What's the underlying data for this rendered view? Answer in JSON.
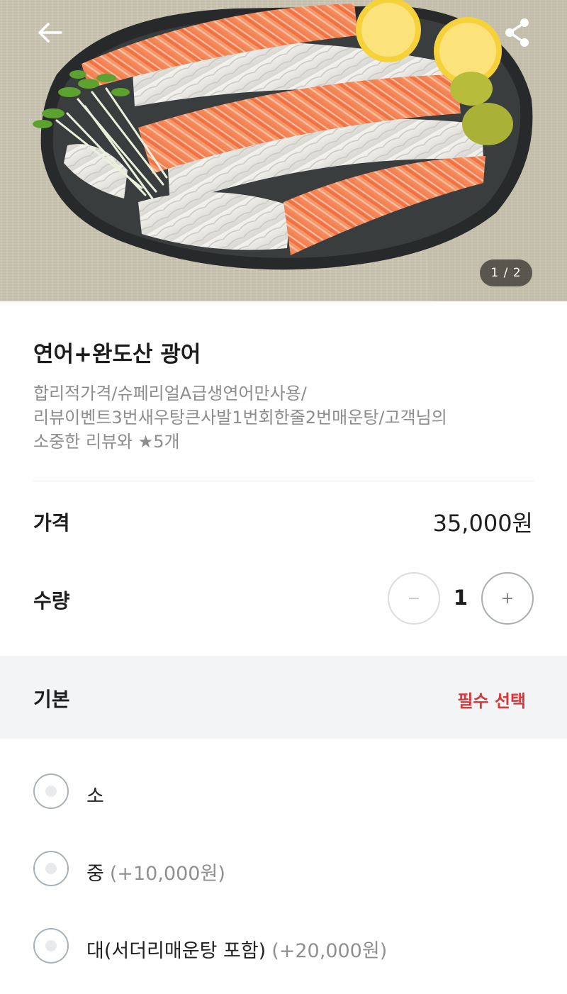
{
  "header": {
    "back_icon": "arrow-left-icon",
    "share_icon": "share-icon",
    "image_counter": "1 / 2"
  },
  "product": {
    "name": "연어+완도산 광어",
    "description_lines": [
      "합리적가격/슈페리얼A급생연어만사용/",
      "리뷰이벤트3번새우탕큰사발1번회한줄2번매운탕/고객님의",
      "소중한 리뷰와 ★5개"
    ]
  },
  "price": {
    "label": "가격",
    "value": "35,000원"
  },
  "quantity": {
    "label": "수량",
    "value": "1",
    "minus": "−",
    "plus": "+"
  },
  "option_group": {
    "title": "기본",
    "required_text": "필수 선택",
    "options": [
      {
        "label": "소",
        "extra": ""
      },
      {
        "label": "중",
        "extra": "(+10,000원)"
      },
      {
        "label": "대(서더리매운탕 포함)",
        "extra": "(+20,000원)"
      }
    ]
  },
  "colors": {
    "required_accent": "#d9383a",
    "option_extra_text": "#909090",
    "description_text": "#8d8d8d"
  }
}
